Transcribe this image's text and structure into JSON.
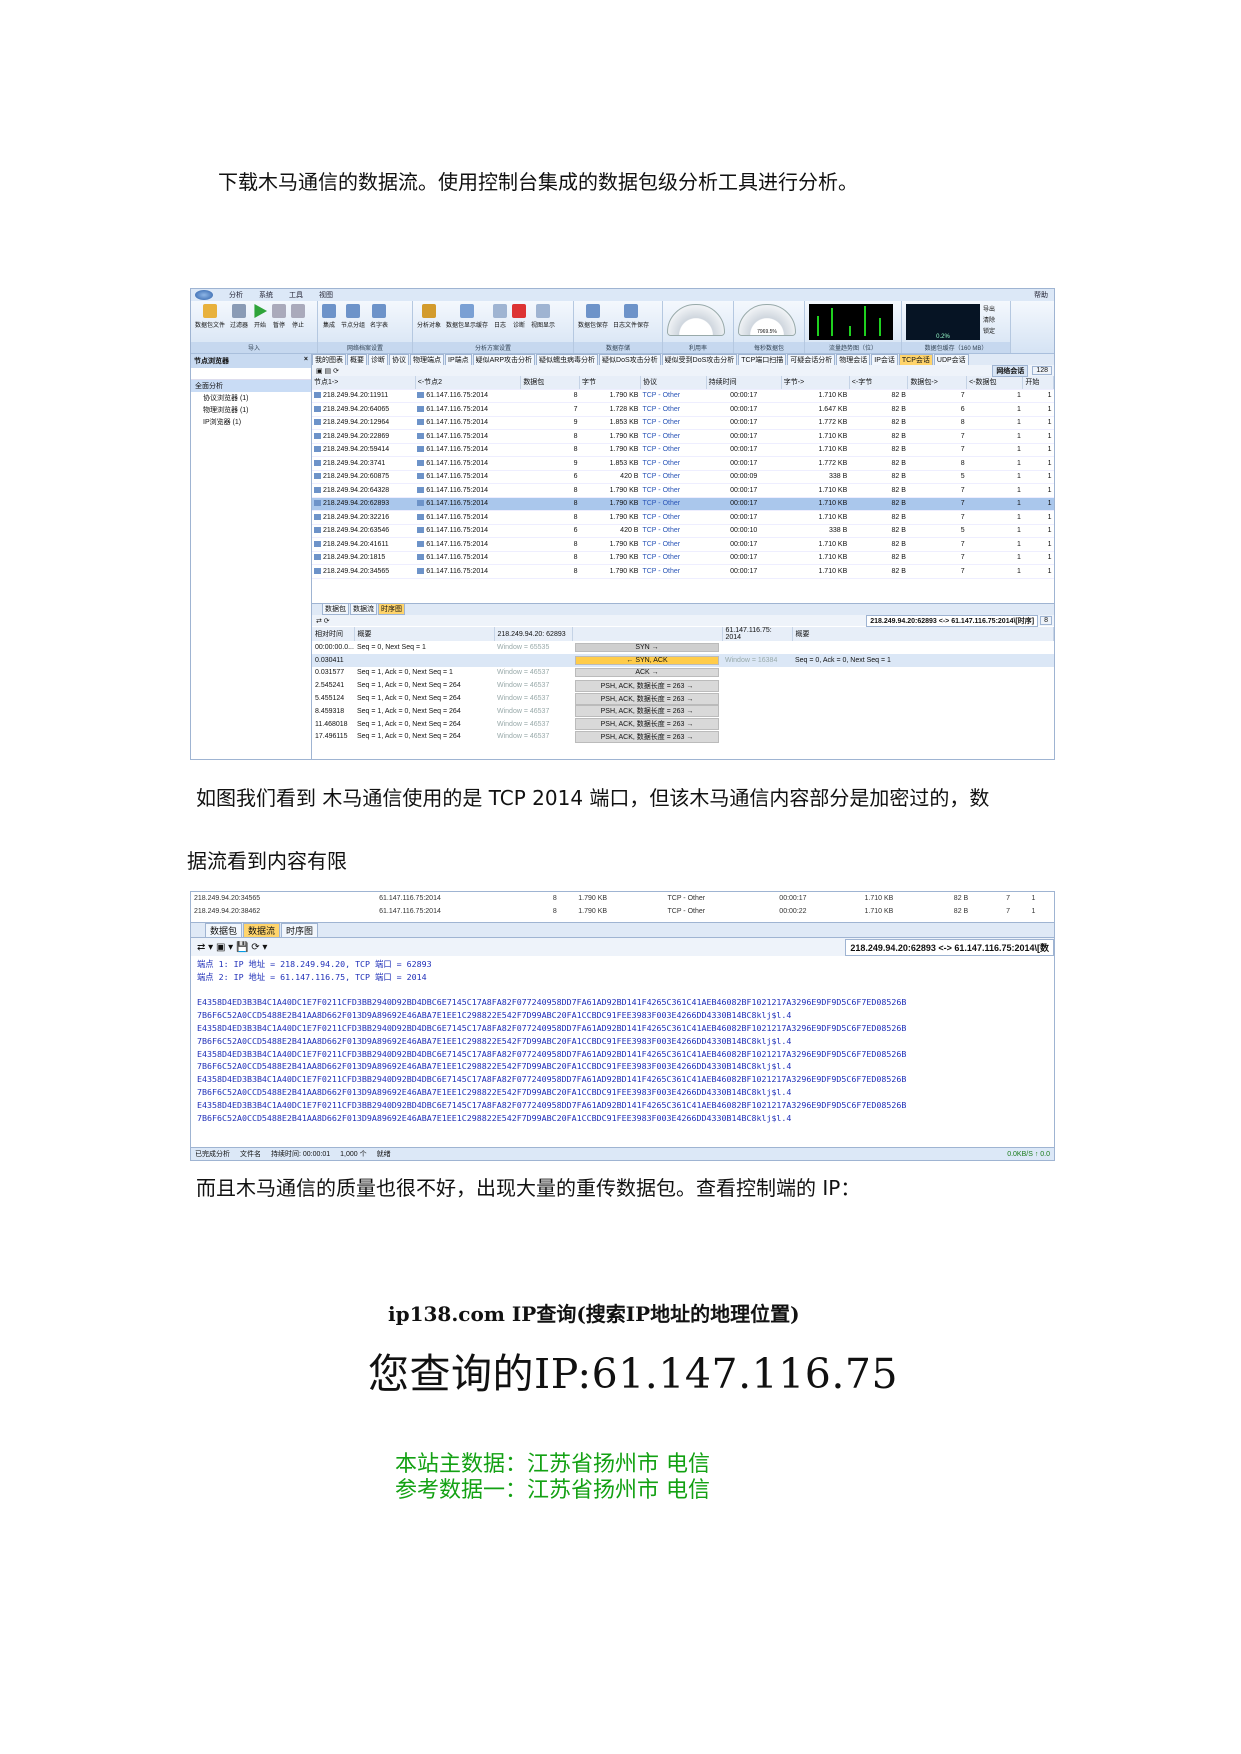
{
  "paragraphs": {
    "p1": "下载木马通信的数据流。使用控制台集成的数据包级分析工具进行分析。",
    "p2": "如图我们看到  木马通信使用的是 TCP 2014 端口，但该木马通信内容部分是加密过的，数",
    "p3": "据流看到内容有限",
    "p4": "而且木马通信的质量也很不好，出现大量的重传数据包。查看控制端的 IP："
  },
  "shot1": {
    "menu": [
      "分析",
      "系统",
      "工具",
      "视图"
    ],
    "help": "帮助",
    "ribbon": [
      {
        "label": "导入",
        "buttons": [
          "数据包文件",
          "过滤器",
          "开始",
          "暂停",
          "停止"
        ]
      },
      {
        "label": "网络档案设置",
        "buttons": [
          "集成",
          "节点分组",
          "名字表"
        ]
      },
      {
        "label": "分析方案设置",
        "buttons": [
          "分析对象",
          "数据包显示缓存",
          "日志",
          "诊断",
          "视图显示"
        ]
      },
      {
        "label": "数据存储",
        "buttons": [
          "数据包保存",
          "日志文件保存"
        ]
      },
      {
        "label": "利用率",
        "buttons": []
      },
      {
        "label": "每秒数据包",
        "buttons": []
      },
      {
        "label": "流量趋势图（位）",
        "buttons": []
      },
      {
        "label": "数据包缓存（160 MB）",
        "buttons": []
      }
    ],
    "gauge_values": [
      "",
      "7969.5%"
    ],
    "buffer_pct": "0.2%",
    "side_buttons": [
      "导出",
      "清除",
      "锁定"
    ],
    "left_panel": {
      "title": "节点浏览器",
      "tree": [
        "全面分析",
        "协议浏览器 (1)",
        "物理浏览器 (1)",
        "IP浏览器 (1)"
      ]
    },
    "view_tabs": [
      "我的图表",
      "概要",
      "诊断",
      "协议",
      "物理端点",
      "IP端点",
      "疑似ARP攻击分析",
      "疑似蠕虫病毒分析",
      "疑似DoS攻击分析",
      "疑似受到DoS攻击分析",
      "TCP端口扫描",
      "可疑会话分析",
      "物理会话",
      "IP会话",
      "TCP会话",
      "UDP会话"
    ],
    "active_view_tab": "TCP会话",
    "net_session_btn": "网络会话",
    "session_count": "128",
    "columns": [
      "节点1->",
      "<-节点2",
      "数据包",
      "字节",
      "协议",
      "持续时间",
      "字节->",
      "<-字节",
      "数据包->",
      "<-数据包",
      "开始"
    ],
    "rows": [
      [
        "218.249.94.20:11911",
        "61.147.116.75:2014",
        "8",
        "1.790 KB",
        "TCP - Other",
        "00:00:17",
        "1.710 KB",
        "82 B",
        "7",
        "1"
      ],
      [
        "218.249.94.20:64065",
        "61.147.116.75:2014",
        "7",
        "1.728 KB",
        "TCP - Other",
        "00:00:17",
        "1.647 KB",
        "82 B",
        "6",
        "1"
      ],
      [
        "218.249.94.20:12964",
        "61.147.116.75:2014",
        "9",
        "1.853 KB",
        "TCP - Other",
        "00:00:17",
        "1.772 KB",
        "82 B",
        "8",
        "1"
      ],
      [
        "218.249.94.20:22869",
        "61.147.116.75:2014",
        "8",
        "1.790 KB",
        "TCP - Other",
        "00:00:17",
        "1.710 KB",
        "82 B",
        "7",
        "1"
      ],
      [
        "218.249.94.20:59414",
        "61.147.116.75:2014",
        "8",
        "1.790 KB",
        "TCP - Other",
        "00:00:17",
        "1.710 KB",
        "82 B",
        "7",
        "1"
      ],
      [
        "218.249.94.20:3741",
        "61.147.116.75:2014",
        "9",
        "1.853 KB",
        "TCP - Other",
        "00:00:17",
        "1.772 KB",
        "82 B",
        "8",
        "1"
      ],
      [
        "218.249.94.20:60875",
        "61.147.116.75:2014",
        "6",
        "420 B",
        "TCP - Other",
        "00:00:09",
        "338 B",
        "82 B",
        "5",
        "1"
      ],
      [
        "218.249.94.20:64328",
        "61.147.116.75:2014",
        "8",
        "1.790 KB",
        "TCP - Other",
        "00:00:17",
        "1.710 KB",
        "82 B",
        "7",
        "1"
      ],
      [
        "218.249.94.20:62893",
        "61.147.116.75:2014",
        "8",
        "1.790 KB",
        "TCP - Other",
        "00:00:17",
        "1.710 KB",
        "82 B",
        "7",
        "1"
      ],
      [
        "218.249.94.20:32216",
        "61.147.116.75:2014",
        "8",
        "1.790 KB",
        "TCP - Other",
        "00:00:17",
        "1.710 KB",
        "82 B",
        "7",
        "1"
      ],
      [
        "218.249.94.20:63546",
        "61.147.116.75:2014",
        "6",
        "420 B",
        "TCP - Other",
        "00:00:10",
        "338 B",
        "82 B",
        "5",
        "1"
      ],
      [
        "218.249.94.20:41611",
        "61.147.116.75:2014",
        "8",
        "1.790 KB",
        "TCP - Other",
        "00:00:17",
        "1.710 KB",
        "82 B",
        "7",
        "1"
      ],
      [
        "218.249.94.20:1815",
        "61.147.116.75:2014",
        "8",
        "1.790 KB",
        "TCP - Other",
        "00:00:17",
        "1.710 KB",
        "82 B",
        "7",
        "1"
      ],
      [
        "218.249.94.20:34565",
        "61.147.116.75:2014",
        "8",
        "1.790 KB",
        "TCP - Other",
        "00:00:17",
        "1.710 KB",
        "82 B",
        "7",
        "1"
      ]
    ],
    "selected_row": 8,
    "bottom_tabs": [
      "数据包",
      "数据流",
      "时序图"
    ],
    "bottom_active": "时序图",
    "conversation": "218.249.94.20:62893 <-> 61.147.116.75:2014\\[时序]",
    "page": "8",
    "seq_headers": [
      "相对时间",
      "概要",
      "218.249.94.20: 62893",
      "",
      "61.147.116.75: 2014",
      "概要"
    ],
    "seq_rows": [
      {
        "t": "00:00:00.0...",
        "sum_l": "Seq = 0, Next Seq = 1",
        "win_l": "Window = 65535",
        "label": "SYN",
        "dir": "r",
        "win_r": "",
        "sum_r": ""
      },
      {
        "t": "0.030411",
        "sum_l": "",
        "win_l": "",
        "label": "SYN, ACK",
        "dir": "l",
        "win_r": "Window = 16384",
        "sum_r": "Seq = 0, Ack = 0, Next Seq = 1"
      },
      {
        "t": "0.031577",
        "sum_l": "Seq = 1, Ack = 0, Next Seq = 1",
        "win_l": "Window = 46537",
        "label": "ACK",
        "dir": "r",
        "win_r": "",
        "sum_r": ""
      },
      {
        "t": "2.545241",
        "sum_l": "Seq = 1, Ack = 0, Next Seq = 264",
        "win_l": "Window = 46537",
        "label": "PSH, ACK, 数据长度 = 263",
        "dir": "r",
        "win_r": "",
        "sum_r": ""
      },
      {
        "t": "5.455124",
        "sum_l": "Seq = 1, Ack = 0, Next Seq = 264",
        "win_l": "Window = 46537",
        "label": "PSH, ACK, 数据长度 = 263",
        "dir": "r",
        "win_r": "",
        "sum_r": ""
      },
      {
        "t": "8.459318",
        "sum_l": "Seq = 1, Ack = 0, Next Seq = 264",
        "win_l": "Window = 46537",
        "label": "PSH, ACK, 数据长度 = 263",
        "dir": "r",
        "win_r": "",
        "sum_r": ""
      },
      {
        "t": "11.468018",
        "sum_l": "Seq = 1, Ack = 0, Next Seq = 264",
        "win_l": "Window = 46537",
        "label": "PSH, ACK, 数据长度 = 263",
        "dir": "r",
        "win_r": "",
        "sum_r": ""
      },
      {
        "t": "17.496115",
        "sum_l": "Seq = 1, Ack = 0, Next Seq = 264",
        "win_l": "Window = 46537",
        "label": "PSH, ACK, 数据长度 = 263",
        "dir": "r",
        "win_r": "",
        "sum_r": ""
      }
    ]
  },
  "shot2": {
    "top_rows": [
      [
        "218.249.94.20:34565",
        "61.147.116.75:2014",
        "8",
        "1.790 KB",
        "TCP - Other",
        "00:00:17",
        "1.710 KB",
        "82 B",
        "7",
        "1"
      ],
      [
        "218.249.94.20:38462",
        "61.147.116.75:2014",
        "8",
        "1.790 KB",
        "TCP - Other",
        "00:00:22",
        "1.710 KB",
        "82 B",
        "7",
        "1"
      ]
    ],
    "tabs": [
      "数据包",
      "数据流",
      "时序图"
    ],
    "active_tab": "数据流",
    "conversation": "218.249.94.20:62893 <-> 61.147.116.75:2014\\[数",
    "endpoint1": "端点 1: IP 地址 = 218.249.94.20, TCP 端口 = 62893",
    "endpoint2": "端点 2: IP 地址 = 61.147.116.75, TCP 端口 = 2014",
    "hex_a": "E4358D4ED3B3B4C1A40DC1E7F0211CFD3BB2940D92BD4DBC6E7145C17A8FA82F077240958DD7FA61AD92BD141F4265C361C41AEB46082BF1021217A3296E9DF9D5C6F7ED08526B",
    "hex_b": "7B6F6C52A0CCD5488E2B41AA8D662F013D9A89692E46ABA7E1EE1C298822E542F7D99ABC20FA1CCBDC91FEE3983F003E4266DD4330B14BC8klj$l.4",
    "hex_lines": [
      "a",
      "b",
      "a",
      "b",
      "a",
      "b",
      "a",
      "b",
      "a",
      "b"
    ],
    "status": [
      "已完成分析",
      "文件名",
      "持续时间: 00:00:01",
      "1,000 个",
      "就绪"
    ],
    "status_right": "0.0KB/S  ↑ 0.0"
  },
  "ip138": {
    "title": "ip138.com IP查询(搜索IP地址的地理位置)",
    "big": "您查询的IP:61.147.116.75",
    "line1": "本站主数据：江苏省扬州市 电信",
    "line2": "参考数据一：江苏省扬州市 电信"
  }
}
